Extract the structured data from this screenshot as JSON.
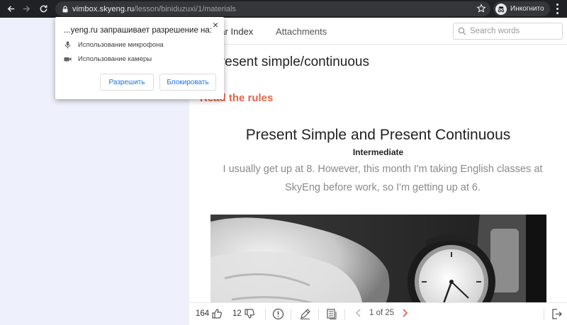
{
  "browser": {
    "url_host": "vimbox.skyeng.ru",
    "url_path": "/lesson/biniduzuxi/1/materials",
    "profile_label": "Инкогнито"
  },
  "popup": {
    "title": "...yeng.ru запрашивает разрешение на:",
    "close": "×",
    "permissions": [
      {
        "label": "Использование микрофона",
        "icon": "microphone-icon"
      },
      {
        "label": "Использование камеры",
        "icon": "camera-icon"
      }
    ],
    "allow_label": "Разрешить",
    "block_label": "Блокировать"
  },
  "tabs": {
    "grammar_index": "Grammar Index",
    "attachments": "Attachments"
  },
  "search": {
    "placeholder": "Search words"
  },
  "lesson": {
    "title": "1. Present simple/continuous",
    "read_rules": "Read the rules",
    "doc_title": "Present Simple and Present Continuous",
    "doc_subtitle": "Intermediate",
    "doc_body": "I usually get up at 8. However, this month I'm taking English classes at SkyEng before work, so I'm getting up at 6."
  },
  "bottom_bar": {
    "likes": "164",
    "comments": "12",
    "pager": "1 of 25"
  },
  "colors": {
    "toolbar_bg": "#202124",
    "accent_orange": "#e0674b",
    "left_pane_bg": "#eef1fb",
    "popup_button_text": "#1a73e8"
  }
}
